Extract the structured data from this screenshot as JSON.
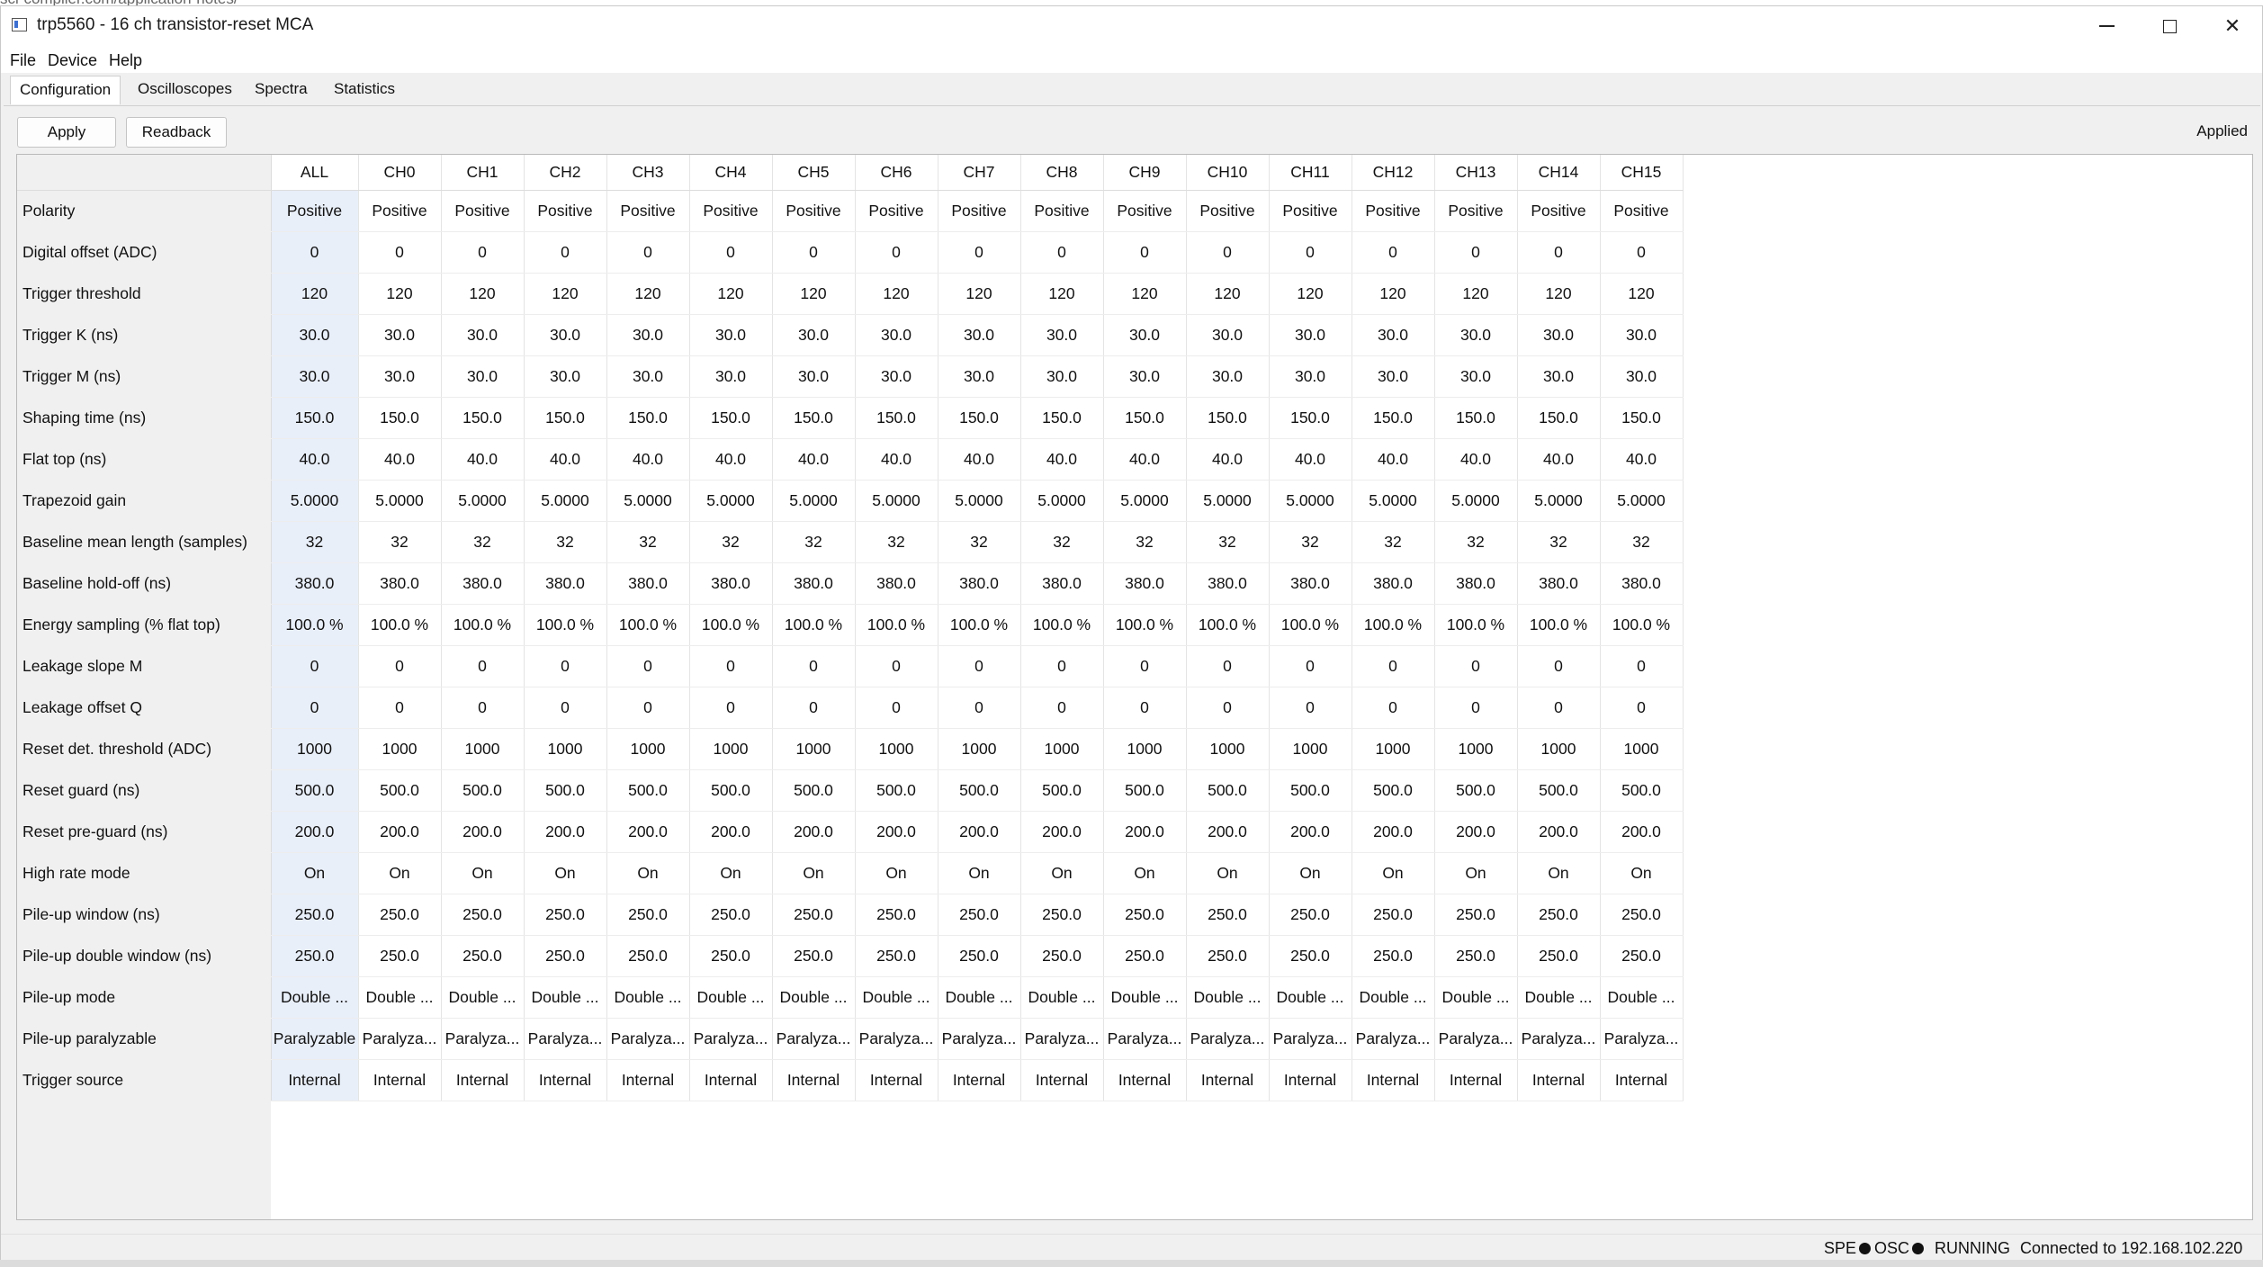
{
  "background": {
    "url_fragment": "sci-compiler.com/application-notes/"
  },
  "window": {
    "title": "trp5560 - 16 ch transistor-reset MCA"
  },
  "menu": {
    "file": "File",
    "device": "Device",
    "help": "Help"
  },
  "tabs": [
    "Configuration",
    "Oscilloscopes",
    "Spectra",
    "Statistics"
  ],
  "toolbar": {
    "apply_label": "Apply",
    "readback_label": "Readback",
    "status": "Applied"
  },
  "table": {
    "columns": [
      "ALL",
      "CH0",
      "CH1",
      "CH2",
      "CH3",
      "CH4",
      "CH5",
      "CH6",
      "CH7",
      "CH8",
      "CH9",
      "CH10",
      "CH11",
      "CH12",
      "CH13",
      "CH14",
      "CH15"
    ],
    "rows": [
      {
        "label": "Polarity",
        "all": "Positive",
        "ch": "Positive"
      },
      {
        "label": "Digital offset (ADC)",
        "all": "0",
        "ch": "0"
      },
      {
        "label": "Trigger threshold",
        "all": "120",
        "ch": "120"
      },
      {
        "label": "Trigger K (ns)",
        "all": "30.0",
        "ch": "30.0"
      },
      {
        "label": "Trigger M (ns)",
        "all": "30.0",
        "ch": "30.0"
      },
      {
        "label": "Shaping time (ns)",
        "all": "150.0",
        "ch": "150.0"
      },
      {
        "label": "Flat top (ns)",
        "all": "40.0",
        "ch": "40.0"
      },
      {
        "label": "Trapezoid gain",
        "all": "5.0000",
        "ch": "5.0000"
      },
      {
        "label": "Baseline mean length (samples)",
        "all": "32",
        "ch": "32"
      },
      {
        "label": "Baseline hold-off (ns)",
        "all": "380.0",
        "ch": "380.0"
      },
      {
        "label": "Energy sampling (% flat top)",
        "all": "100.0 %",
        "ch": "100.0 %"
      },
      {
        "label": "Leakage slope M",
        "all": "0",
        "ch": "0"
      },
      {
        "label": "Leakage offset Q",
        "all": "0",
        "ch": "0"
      },
      {
        "label": "Reset det. threshold (ADC)",
        "all": "1000",
        "ch": "1000"
      },
      {
        "label": "Reset guard (ns)",
        "all": "500.0",
        "ch": "500.0"
      },
      {
        "label": "Reset pre-guard (ns)",
        "all": "200.0",
        "ch": "200.0"
      },
      {
        "label": "High rate mode",
        "all": "On",
        "ch": "On"
      },
      {
        "label": "Pile-up window (ns)",
        "all": "250.0",
        "ch": "250.0"
      },
      {
        "label": "Pile-up double window (ns)",
        "all": "250.0",
        "ch": "250.0"
      },
      {
        "label": "Pile-up mode",
        "all": "Double ...",
        "ch": "Double ..."
      },
      {
        "label": "Pile-up paralyzable",
        "all": "Paralyzable",
        "ch": "Paralyza..."
      },
      {
        "label": "Trigger source",
        "all": "Internal",
        "ch": "Internal"
      }
    ]
  },
  "statusbar": {
    "spe": "SPE",
    "osc": "OSC",
    "state": "RUNNING",
    "connection": "Connected to 192.168.102.220"
  },
  "colors": {
    "all_column_bg": "#e9eff9",
    "gutter_bg": "#f0f0f0"
  }
}
